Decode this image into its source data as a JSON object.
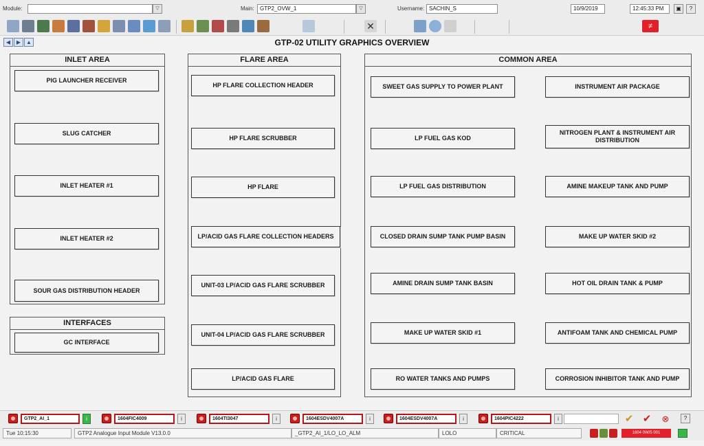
{
  "header": {
    "module_label": "Module:",
    "module_value": "",
    "main_label": "Main:",
    "main_value": "GTP2_OVW_1",
    "username_label": "Username:",
    "username_value": "SACHIN_S",
    "date": "10/9/2019",
    "time": "12:45:33 PM",
    "help_label": "?"
  },
  "page_title": "GTP-02 UTILITY GRAPHICS OVERVIEW",
  "inlet_area": {
    "heading": "INLET AREA",
    "items": [
      "PIG LAUNCHER RECEIVER",
      "SLUG CATCHER",
      "INLET HEATER #1",
      "INLET HEATER #2",
      "SOUR GAS DISTRIBUTION HEADER"
    ]
  },
  "interfaces": {
    "heading": "INTERFACES",
    "items": [
      "GC INTERFACE"
    ]
  },
  "flare_area": {
    "heading": "FLARE AREA",
    "items": [
      "HP FLARE COLLECTION HEADER",
      "HP FLARE SCRUBBER",
      "HP FLARE",
      "LP/ACID GAS FLARE COLLECTION HEADERS",
      "UNIT-03 LP/ACID GAS FLARE SCRUBBER",
      "UNIT-04 LP/ACID GAS FLARE SCRUBBER",
      "LP/ACID GAS FLARE"
    ]
  },
  "common_area": {
    "heading": "COMMON AREA",
    "left_items": [
      "SWEET GAS SUPPLY TO POWER PLANT",
      "LP FUEL GAS KOD",
      "LP FUEL GAS DISTRIBUTION",
      "CLOSED DRAIN SUMP TANK PUMP BASIN",
      "AMINE DRAIN SUMP TANK BASIN",
      "MAKE UP WATER SKID #1",
      "RO WATER TANKS AND PUMPS"
    ],
    "right_items": [
      "INSTRUMENT AIR PACKAGE",
      "NITROGEN PLANT & INSTRUMENT AIR DISTRIBUTION",
      "AMINE MAKEUP TANK AND PUMP",
      "MAKE UP WATER SKID #2",
      "HOT OIL DRAIN TANK & PUMP",
      "ANTIFOAM TANK AND CHEMICAL PUMP",
      "CORROSION INHIBITOR TANK AND PUMP"
    ]
  },
  "alarms": {
    "tags": [
      "GTP2_AI_1",
      "1604FIC4009",
      "1604TI3047",
      "1604ESDV4007A",
      "1604ESDV4007A",
      "1604PIC4222"
    ],
    "info_label": "i",
    "help_label": "?"
  },
  "status": {
    "time": "Tue 10:15:30",
    "module": "GTP2 Analogue Input  Module V13.0.0",
    "tag": "_GTP2_AI_1/LO_LO_ALM",
    "limit": "LOLO",
    "priority": "CRITICAL",
    "counter": "1604 0W/5 001"
  },
  "colors": {
    "alarm_red": "#c81e1e",
    "panel_border": "#555555",
    "background": "#f2f2f2"
  }
}
